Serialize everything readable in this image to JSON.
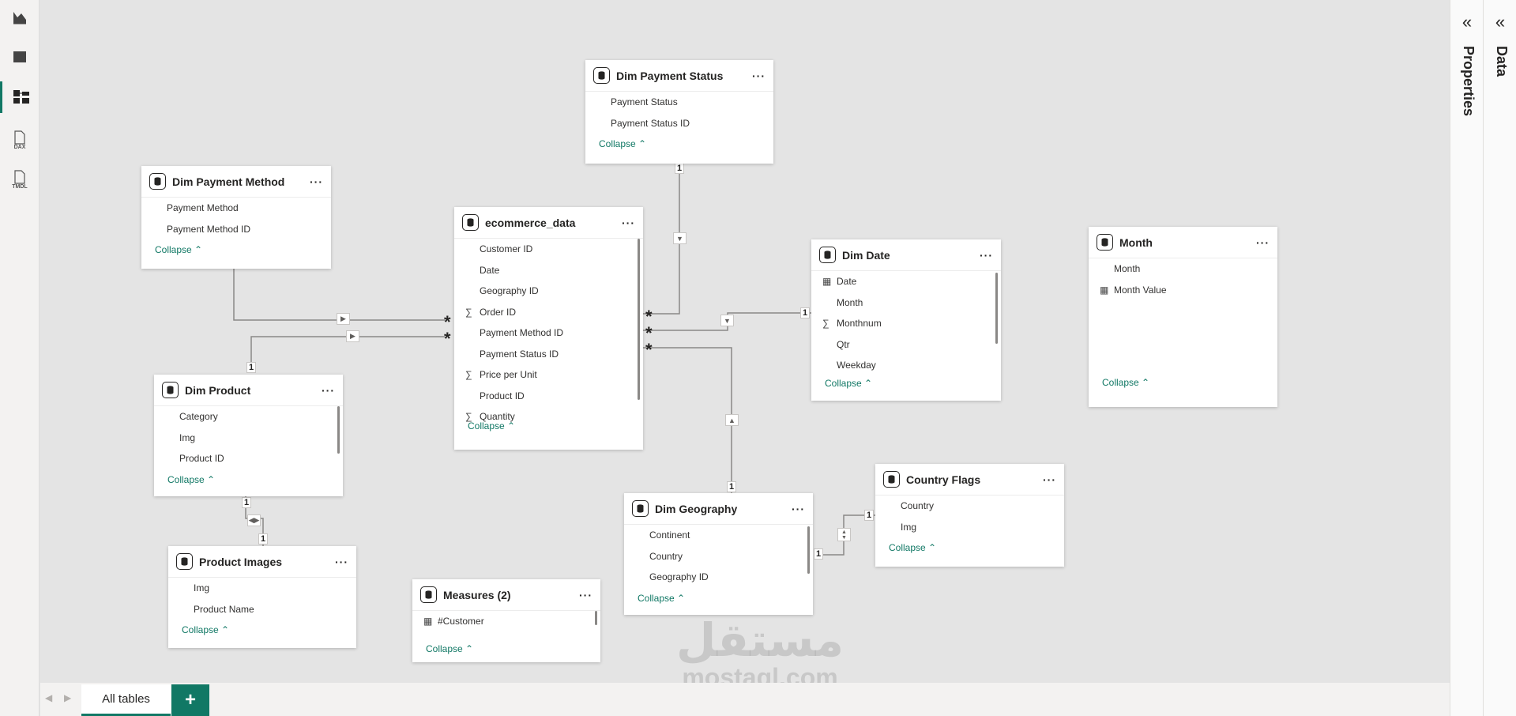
{
  "nav": {
    "items": [
      {
        "name": "report-view",
        "label": ""
      },
      {
        "name": "table-view",
        "label": ""
      },
      {
        "name": "model-view",
        "label": ""
      },
      {
        "name": "dax-query-view",
        "label": "DAX"
      },
      {
        "name": "tmdl-view",
        "label": "TMDL"
      }
    ]
  },
  "tables": {
    "payment_status": {
      "title": "Dim Payment Status",
      "fields": [
        "Payment Status",
        "Payment Status ID"
      ],
      "collapse": "Collapse"
    },
    "payment_method": {
      "title": "Dim Payment Method",
      "fields": [
        "Payment Method",
        "Payment Method ID"
      ],
      "collapse": "Collapse"
    },
    "ecommerce": {
      "title": "ecommerce_data",
      "fields": [
        "Customer ID",
        "Date",
        "Geography ID",
        "Order ID",
        "Payment Method ID",
        "Payment Status ID",
        "Price per Unit",
        "Product ID",
        "Quantity"
      ],
      "sum_fields": [
        3,
        6,
        8
      ],
      "collapse": "Collapse"
    },
    "date": {
      "title": "Dim Date",
      "fields": [
        "Date",
        "Month",
        "Monthnum",
        "Qtr",
        "Weekday"
      ],
      "collapse": "Collapse"
    },
    "month": {
      "title": "Month",
      "fields": [
        "Month",
        "Month Value"
      ],
      "collapse": "Collapse"
    },
    "product": {
      "title": "Dim Product",
      "fields": [
        "Category",
        "Img",
        "Product ID"
      ],
      "collapse": "Collapse"
    },
    "product_images": {
      "title": "Product Images",
      "fields": [
        "Img",
        "Product Name"
      ],
      "collapse": "Collapse"
    },
    "measures": {
      "title": "Measures (2)",
      "fields": [
        "#Customer"
      ],
      "collapse": "Collapse"
    },
    "geography": {
      "title": "Dim Geography",
      "fields": [
        "Continent",
        "Country",
        "Geography ID"
      ],
      "collapse": "Collapse"
    },
    "country_flags": {
      "title": "Country Flags",
      "fields": [
        "Country",
        "Img"
      ],
      "collapse": "Collapse"
    }
  },
  "cardinality": {
    "one": "1",
    "many": "*"
  },
  "panes": {
    "properties": "Properties",
    "data": "Data"
  },
  "tabs": {
    "all_tables": "All tables",
    "add": "+"
  },
  "watermark": {
    "arabic": "مستقل",
    "latin": "mostaql.com"
  },
  "colors": {
    "accent": "#117865",
    "canvas": "#e4e4e4",
    "card": "#ffffff",
    "line": "#8a8886"
  }
}
